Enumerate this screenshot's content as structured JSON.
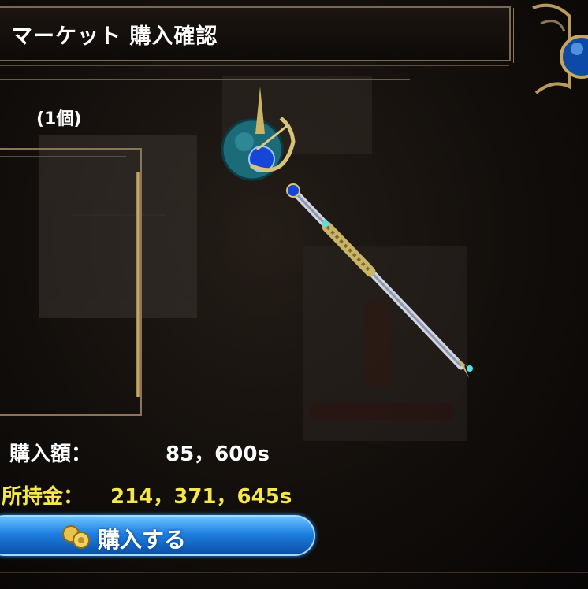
{
  "header": {
    "title": "マーケット 購入確認"
  },
  "item": {
    "quantity": "(1個)",
    "name_icon": "staff-icon"
  },
  "purchase": {
    "price_label": "購入額：",
    "price_value": "85，600s",
    "money_label": "所持金：",
    "money_value": "214，371，645s"
  },
  "buy_button": {
    "label": "購入する",
    "icon": "coins-icon"
  },
  "colors": {
    "money_yellow": "#f5e64b",
    "button_blue": "#1f7fe0",
    "frame_gold": "#8a7656"
  }
}
